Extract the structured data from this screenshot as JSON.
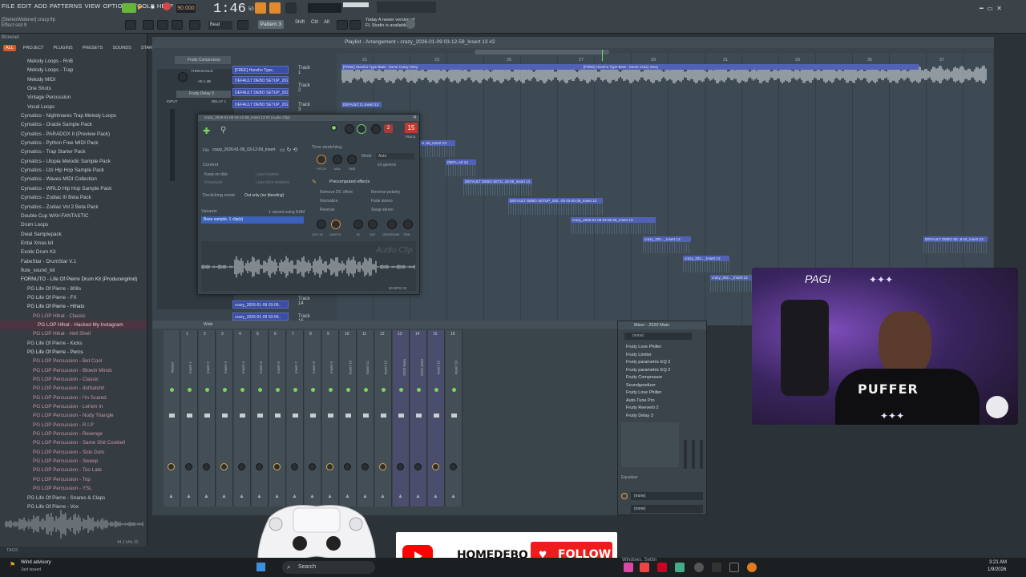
{
  "menu": [
    "FILE",
    "EDIT",
    "ADD",
    "PATTERNS",
    "VIEW",
    "OPTIONS",
    "TOOLS",
    "HELP"
  ],
  "hint": {
    "line1": "[StereoWidener] crazy.flp",
    "line2": "Effect slot 9"
  },
  "transport": {
    "bpm": "90.000",
    "time": "1:46",
    "time_small": "50",
    "pattern": "Pattern 3",
    "beat_label": "Beat"
  },
  "news": {
    "line1": "Today  A newer version of",
    "line2": "FL Studio is available!"
  },
  "browser": {
    "title": "Browser",
    "tabs": [
      "ALL",
      "PROJECT",
      "PLUGINS",
      "PRESETS",
      "SOUNDS",
      "STARRED"
    ],
    "items": [
      {
        "label": "Melody Loops - RnB",
        "lvl": "l1"
      },
      {
        "label": "Melody Loops - Trap",
        "lvl": "l1"
      },
      {
        "label": "Melody MIDI",
        "lvl": "l1"
      },
      {
        "label": "One Shots",
        "lvl": "l1"
      },
      {
        "label": "Vintage Percussion",
        "lvl": "l1"
      },
      {
        "label": "Vocal Loops",
        "lvl": "l1"
      },
      {
        "label": "Cymatics - Nightmares Trap Melody Loops",
        "lvl": "l0"
      },
      {
        "label": "Cymatics - Oracle Sample Pack",
        "lvl": "l0"
      },
      {
        "label": "Cymatics - PARADOX II (Preview Pack)",
        "lvl": "l0"
      },
      {
        "label": "Cymatics - Python Free MIDI Pack",
        "lvl": "l0"
      },
      {
        "label": "Cymatics - Trap Starter Pack",
        "lvl": "l0"
      },
      {
        "label": "Cymatics - Utopia Melodic Sample Pack",
        "lvl": "l0"
      },
      {
        "label": "Cymatics - Uzi Hip Hop Sample Pack",
        "lvl": "l0"
      },
      {
        "label": "Cymatics - Waves MIDI Collection",
        "lvl": "l0"
      },
      {
        "label": "Cymatics - WRLD Hip Hop Sample Pack",
        "lvl": "l0"
      },
      {
        "label": "Cymatics - Zodiac III Beta Pack",
        "lvl": "l0"
      },
      {
        "label": "Cymatics - Zodiac Vol 2 Beta Pack",
        "lvl": "l0"
      },
      {
        "label": "Double Cup WAV-FANTASTIC",
        "lvl": "l0"
      },
      {
        "label": "Drum Loops",
        "lvl": "l0"
      },
      {
        "label": "Dwat Samplepack",
        "lvl": "l0"
      },
      {
        "label": "Entai Xmas kit",
        "lvl": "l0"
      },
      {
        "label": "Exotic Drum Kit",
        "lvl": "l0"
      },
      {
        "label": "FabeStar - DrumStar V.1",
        "lvl": "l0"
      },
      {
        "label": "flute_sound_kit",
        "lvl": "l0"
      },
      {
        "label": "FORNUTO - Life Of Pierre Drum Kit (Producergrind)",
        "lvl": "l0 open"
      },
      {
        "label": "PG Life Of Pierre - 808s",
        "lvl": "l1"
      },
      {
        "label": "PG Life Of Pierre - FX",
        "lvl": "l1"
      },
      {
        "label": "PG Life Of Pierre - Hihats",
        "lvl": "l1 open"
      },
      {
        "label": "PG LOP Hihat - Classic",
        "lvl": "l2"
      },
      {
        "label": "PG LOP Hihat - Hacked My Instagram",
        "lvl": "l3"
      },
      {
        "label": "PG LOP Hihat - Hell Shell",
        "lvl": "l2"
      },
      {
        "label": "PG Life Of Pierre - Kicks",
        "lvl": "l1"
      },
      {
        "label": "PG Life Of Pierre - Percs",
        "lvl": "l1 open"
      },
      {
        "label": "PG LOP Percussion - Bet Cool",
        "lvl": "l2"
      },
      {
        "label": "PG LOP Percussion - Blowin Minds",
        "lvl": "l2"
      },
      {
        "label": "PG LOP Percussion - Classic",
        "lvl": "l2"
      },
      {
        "label": "PG LOP Percussion - dothatshit",
        "lvl": "l2"
      },
      {
        "label": "PG LOP Percussion - I'm Scared",
        "lvl": "l2"
      },
      {
        "label": "PG LOP Percussion - Let'em In",
        "lvl": "l2"
      },
      {
        "label": "PG LOP Percussion - Nudy Triangle",
        "lvl": "l2"
      },
      {
        "label": "PG LOP Percussion - R.I.P",
        "lvl": "l2"
      },
      {
        "label": "PG LOP Percussion - Revenge",
        "lvl": "l2"
      },
      {
        "label": "PG LOP Percussion - Same Shit Cowbell",
        "lvl": "l2"
      },
      {
        "label": "PG LOP Percussion - Solo Dolo",
        "lvl": "l2"
      },
      {
        "label": "PG LOP Percussion - Sweep",
        "lvl": "l2"
      },
      {
        "label": "PG LOP Percussion - Too Late",
        "lvl": "l2"
      },
      {
        "label": "PG LOP Percussion - Top",
        "lvl": "l2"
      },
      {
        "label": "PG LOP Percussion - YSL",
        "lvl": "l2"
      },
      {
        "label": "PG Life Of Pierre - Snares & Claps",
        "lvl": "l1"
      },
      {
        "label": "PG Life Of Pierre - Vox",
        "lvl": "l1"
      }
    ],
    "preview_info": "44.1 kHz 32",
    "tags": "TAGS"
  },
  "playlist": {
    "title": "Playlist - Arrangement  › crazy_2026-01-09 03-12-59_Insert 13 #2",
    "tracks": [
      "Track 1",
      "Track 2",
      "Track 3",
      "Track 14",
      "Track 16"
    ],
    "ruler": [
      "21",
      "23",
      "25",
      "27",
      "29",
      "31",
      "33",
      "35",
      "37"
    ],
    "clips": [
      "[FREE] Hunxho Type Beat - Some Crazy Story",
      "[FREE] Hunxho Type Beat - Some Crazy Story",
      "DEFAULT D..Insert 13",
      "D..55_Insert 13",
      "DEFA..ert 13",
      "DEFAULT DEBO SETU..18-09_Insert 13",
      "DEFAULT DEBO SETUP_202..-03 02-20-38_Insert 13",
      "crazy_2026-01-09 03-05-25_Insert 13",
      "crazy_202..._Insert 13",
      "crazy_202..._Insert 13",
      "crazy_202..._Insert 13",
      "DEFAULT DEBO SE..8-15_Insert 13"
    ],
    "picker": [
      "[FREE] Hunxho Type..",
      "DEFAULT DEBO SETUP_202..",
      "DEFAULT DEBO SETUP_202..",
      "DEFAULT DEBO SETUP_202..",
      "crazy_2026-01-09 03-09..",
      "crazy_2026-01-09 03-09.."
    ]
  },
  "audio_clip": {
    "title": "crazy_2026-01-09 03-12-59_Insert 13 #2 (Audio Clip)",
    "file_label": "File",
    "file": "crazy_2026-01-09_03-12-59_Insert 13.wav",
    "content_label": "Content",
    "keep": "Keep on disk",
    "resample": "Resample",
    "load_regions": "Load regions",
    "load_slices": "Load slice markers",
    "declicking_label": "Declicking mode",
    "declicking": "Out only (no bleeding)",
    "variants_label": "Variants",
    "variants_using": "1 variant using RAM",
    "variant": "Base sample, 1 clip(s)",
    "stretch_label": "Time stretching",
    "mode_label": "Mode",
    "mode": "Auto",
    "generic": "e3 generic",
    "pitch": "PITCH",
    "mul": "MUL",
    "time": "TIME",
    "precomp": "Precomputed effects",
    "fx_left": [
      "Remove DC offset",
      "Normalize",
      "Reverse"
    ],
    "fx_right": [
      "Reverse polarity",
      "Fade stereo",
      "Swap stereo"
    ],
    "knobs": [
      "OUT / IN",
      "LENGTH",
      "IN",
      "OUT",
      "CROSSFADE",
      "TRIM"
    ],
    "watermark": "Audio Clip",
    "bpm": "90 BPM 32",
    "track": "15",
    "track_label": "TRACK",
    "badge": "2"
  },
  "plugin_windows": {
    "compressor": "Fruity Compressor",
    "delay": "Fruity Delay 3",
    "threshold": "THRESHOLD",
    "value": "-40.1 dB",
    "input": "INPUT",
    "delay_label": "DELAY 1"
  },
  "mixer": {
    "width_label": "Wide",
    "insert_labels": [
      "Master",
      "Insert 1",
      "Insert 2",
      "Insert 3",
      "Insert 4",
      "Insert 5",
      "Insert 6",
      "Insert 7",
      "Insert 8",
      "Insert 9",
      "Insert 10",
      "Insert 11",
      "Insert 12",
      "2020 Main",
      "2020 Main",
      "Insert 15",
      "Insert 16"
    ],
    "numbers": [
      "1",
      "2",
      "3",
      "4",
      "5",
      "6",
      "7",
      "8",
      "9",
      "10",
      "11",
      "12",
      "13",
      "14",
      "15",
      "16"
    ]
  },
  "mixer_panel": {
    "title": "Mixer - 2020 Main",
    "preset": "(none)",
    "fx": [
      "Fruity Love Philter",
      "Fruity Limiter",
      "Fruity parametric EQ 2",
      "Fruity parametric EQ 2",
      "Fruity Compressor",
      "Soundgoodizer",
      "Fruity Love Philter",
      "Auto-Tune Pro",
      "Fruity Reeverb 2",
      "Fruity Delay 3"
    ],
    "eq_label": "Equalizer",
    "out1": "(none)",
    "out2": "(none)"
  },
  "webcam": {
    "shirt": "PUFFER",
    "tag": "PAGI"
  },
  "banner": {
    "channel": "HOMEDEBO",
    "follow": "FOLLOW"
  },
  "taskbar": {
    "weather": "Wind advisory",
    "weather_sub": "Just issued",
    "search": "Search",
    "time": "3:21 AM",
    "date": "1/9/2026",
    "windows_text": "Windows. Settin"
  },
  "colors": {
    "accent": "#d65a2d",
    "clip": "#3b4ea7",
    "youtube": "#ff0000",
    "selected": "#3b61b8"
  }
}
